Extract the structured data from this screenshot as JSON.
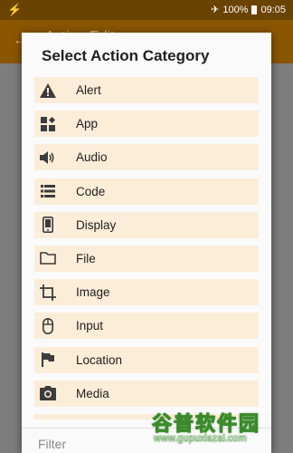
{
  "statusbar": {
    "left_icon": "bolt-icon",
    "airplane_icon": "airplane-icon",
    "battery_text": "100%",
    "time": "09:05"
  },
  "appbar": {
    "title": "Action Edit",
    "back_icon": "back-arrow-icon"
  },
  "dialog": {
    "title": "Select Action Category",
    "items": [
      {
        "label": "Alert",
        "icon": "alert-icon"
      },
      {
        "label": "App",
        "icon": "app-icon"
      },
      {
        "label": "Audio",
        "icon": "audio-icon"
      },
      {
        "label": "Code",
        "icon": "code-icon"
      },
      {
        "label": "Display",
        "icon": "display-icon"
      },
      {
        "label": "File",
        "icon": "folder-icon"
      },
      {
        "label": "Image",
        "icon": "crop-icon"
      },
      {
        "label": "Input",
        "icon": "mouse-icon"
      },
      {
        "label": "Location",
        "icon": "flag-icon"
      },
      {
        "label": "Media",
        "icon": "camera-icon"
      }
    ],
    "filter_placeholder": "Filter"
  },
  "watermark": {
    "chinese": "谷普软件园",
    "url": "www.gupuxiazai.com"
  },
  "colors": {
    "status_bar": "#6b4300",
    "app_bar": "#8a5600",
    "item_bg": "#fcedd9",
    "icon": "#3c3c3c"
  }
}
